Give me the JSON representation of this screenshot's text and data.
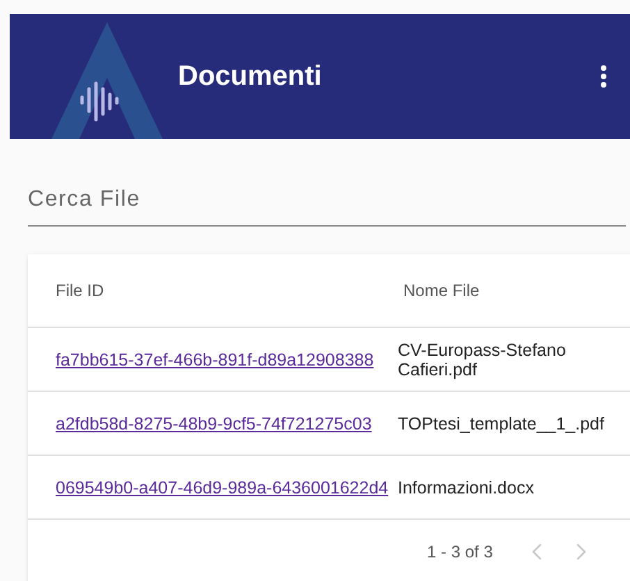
{
  "app_bar": {
    "title": "Documenti"
  },
  "search": {
    "placeholder": "Cerca File"
  },
  "table": {
    "columns": [
      "File ID",
      "Nome File"
    ],
    "rows": [
      {
        "file_id": "fa7bb615-37ef-466b-891f-d89a12908388",
        "name": "CV-Europass-Stefano Cafieri.pdf"
      },
      {
        "file_id": "a2fdb58d-8275-48b9-9cf5-74f721275c03",
        "name": "TOPtesi_template__1_.pdf"
      },
      {
        "file_id": "069549b0-a407-46d9-989a-6436001622d4",
        "name": "Informazioni.docx"
      }
    ]
  },
  "pagination": {
    "range": "1 - 3 of 3",
    "prev": {
      "disabled": true
    },
    "next": {
      "disabled": true
    }
  }
}
